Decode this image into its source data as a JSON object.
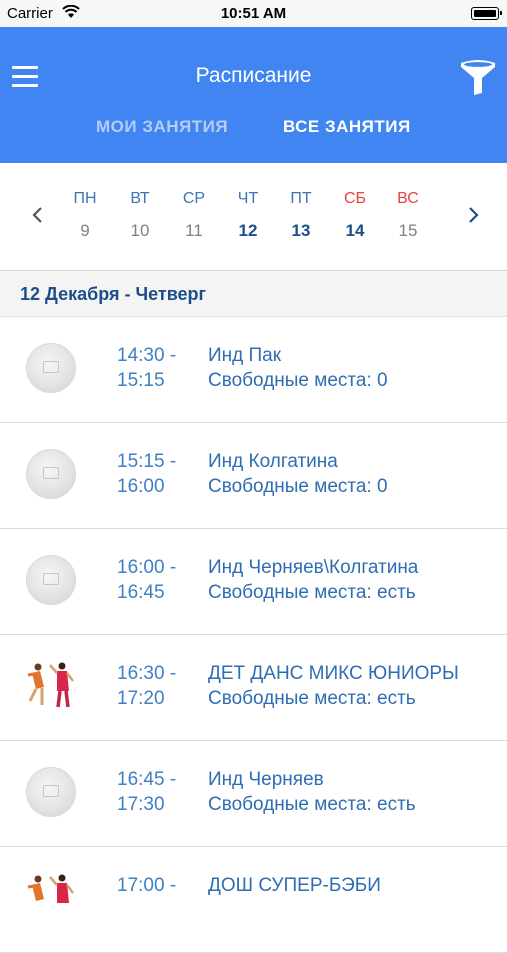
{
  "status_bar": {
    "carrier": "Carrier",
    "time": "10:51 AM"
  },
  "header": {
    "title": "Расписание",
    "tabs": [
      {
        "label": "МОИ ЗАНЯТИЯ",
        "active": false
      },
      {
        "label": "ВСЕ ЗАНЯТИЯ",
        "active": true
      }
    ],
    "background_color": "#4085f1"
  },
  "week": {
    "days": [
      {
        "name": "ПН",
        "num": "9"
      },
      {
        "name": "ВТ",
        "num": "10"
      },
      {
        "name": "СР",
        "num": "11"
      },
      {
        "name": "ЧТ",
        "num": "12"
      },
      {
        "name": "ПТ",
        "num": "13"
      },
      {
        "name": "СБ",
        "num": "14"
      },
      {
        "name": "ВС",
        "num": "15"
      }
    ],
    "weekend_color": "#e8433d",
    "selected_color": "#1d4e8a"
  },
  "date_header": "12 Декабря - Четверг",
  "classes": [
    {
      "start": "14:30 -",
      "end": "15:15",
      "title": "Инд Пак",
      "spots": "Свободные места: 0",
      "image": "placeholder"
    },
    {
      "start": "15:15 -",
      "end": "16:00",
      "title": "Инд Колгатина",
      "spots": "Свободные места: 0",
      "image": "placeholder"
    },
    {
      "start": "16:00 -",
      "end": "16:45",
      "title": "Инд Черняев\\Колгатина",
      "spots": "Свободные места: есть",
      "image": "placeholder"
    },
    {
      "start": "16:30 -",
      "end": "17:20",
      "title": "ДЕТ ДАНС МИКС ЮНИОРЫ",
      "spots": "Свободные места: есть",
      "image": "dancers"
    },
    {
      "start": "16:45 -",
      "end": "17:30",
      "title": "Инд Черняев",
      "spots": "Свободные места: есть",
      "image": "placeholder"
    },
    {
      "start": "17:00 -",
      "end": "",
      "title": "ДОШ СУПЕР-БЭБИ",
      "spots": "",
      "image": "dancers"
    }
  ]
}
